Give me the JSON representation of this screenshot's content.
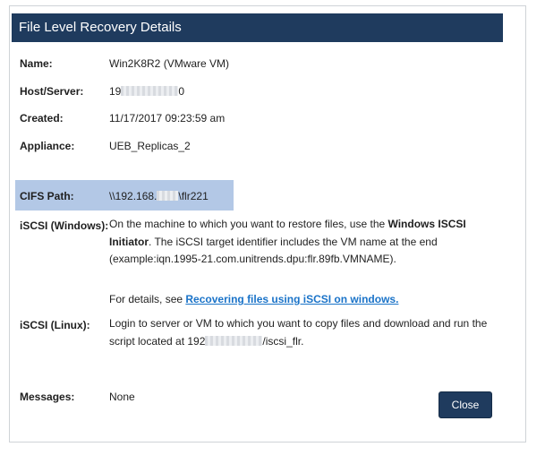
{
  "dialog": {
    "title": "File Level Recovery Details",
    "close_label": "Close"
  },
  "fields": {
    "name": {
      "label": "Name:",
      "value": "Win2K8R2 (VMware VM)"
    },
    "host": {
      "label": "Host/Server:",
      "value_prefix": "19",
      "value_suffix": "0"
    },
    "created": {
      "label": "Created:",
      "value": "11/17/2017 09:23:59 am"
    },
    "appliance": {
      "label": "Appliance:",
      "value": "UEB_Replicas_2"
    },
    "cifs": {
      "label": "CIFS Path:",
      "value_prefix": "\\\\192.168.",
      "value_suffix": "\\flr221"
    },
    "iscsi_windows": {
      "label": "iSCSI (Windows):",
      "text_1": "On the machine to which you want to restore files, use the ",
      "bold_1": "Windows ISCSI Initiator",
      "text_2": ". The iSCSI target identifier includes the VM name at the end (example:iqn.1995-21.com.unitrends.dpu:flr.89fb.VMNAME).",
      "details_prefix": "For details, see ",
      "details_link": "Recovering files using iSCSI on windows."
    },
    "iscsi_linux": {
      "label": "iSCSI (Linux):",
      "text_1": "Login to server or VM to which you want to copy files and download and run the script located at 192",
      "text_2": "/iscsi_flr."
    },
    "messages": {
      "label": "Messages:",
      "value": "None"
    }
  }
}
